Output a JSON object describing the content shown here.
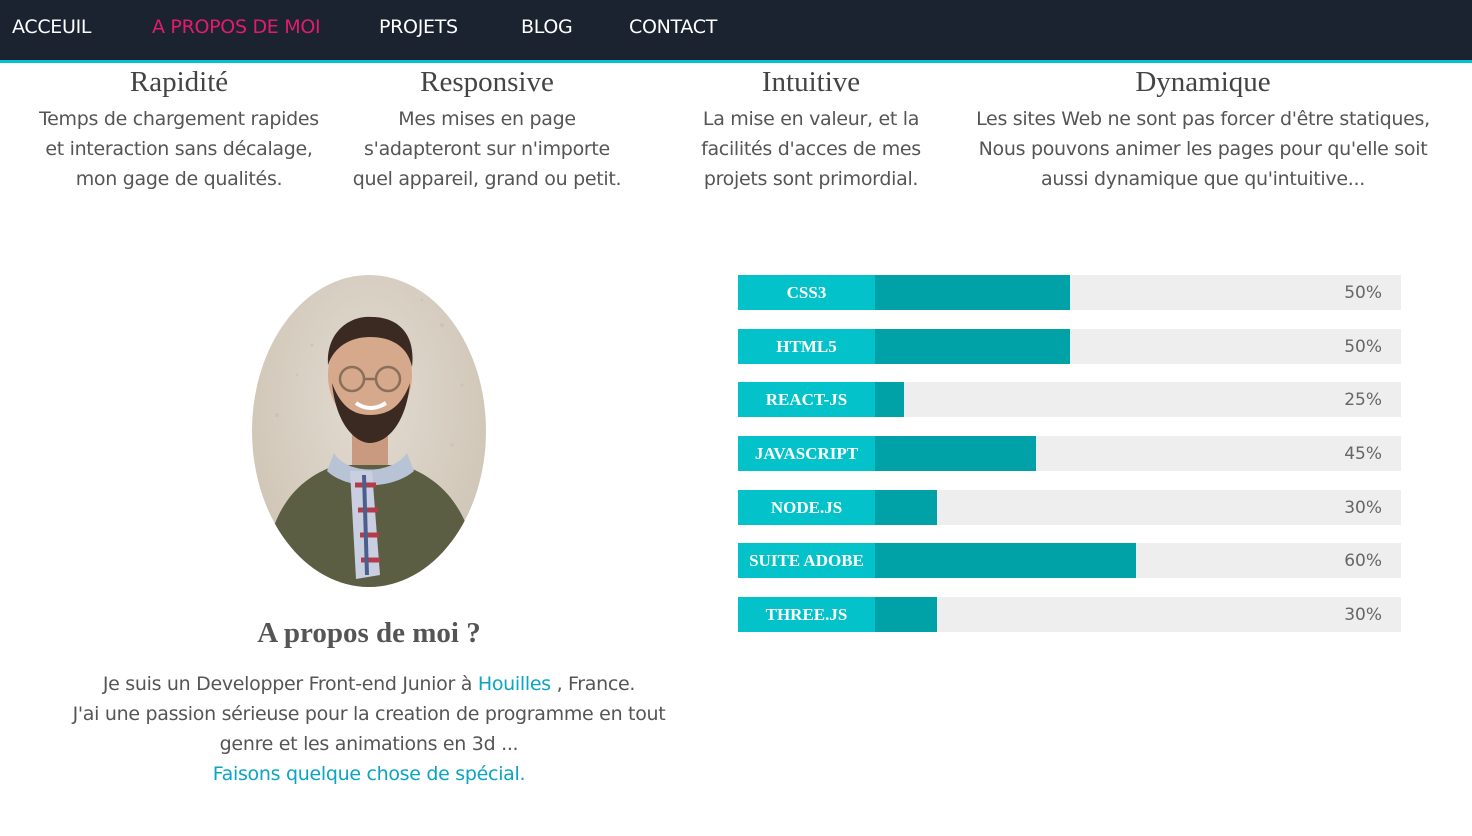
{
  "nav": {
    "items": [
      {
        "label": "ACCEUIL",
        "active": false
      },
      {
        "label": "A PROPOS DE MOI",
        "active": true
      },
      {
        "label": "PROJETS",
        "active": false
      },
      {
        "label": "BLOG",
        "active": false
      },
      {
        "label": "CONTACT",
        "active": false
      }
    ]
  },
  "features": [
    {
      "title": "Rapidité",
      "lines": [
        "Temps de chargement rapides",
        "et interaction sans décalage,",
        "mon gage de qualités."
      ]
    },
    {
      "title": "Responsive",
      "lines": [
        "Mes mises en page",
        "s'adapteront sur n'importe",
        "quel appareil, grand ou petit."
      ]
    },
    {
      "title": "Intuitive",
      "lines": [
        "La mise en valeur, et la",
        "facilités d'acces de mes",
        "projets sont primordial."
      ]
    },
    {
      "title": "Dynamique",
      "lines": [
        "Les sites Web ne sont pas forcer d'être statiques,",
        "Nous pouvons animer les pages pour qu'elle soit",
        "aussi dynamique que qu'intuitive..."
      ]
    }
  ],
  "about": {
    "title": "A propos de moi ?",
    "line1_before": "Je suis un Developper Front-end Junior à",
    "city_link": "Houilles",
    "line1_after": ", France.",
    "line2": "J'ai une passion sérieuse pour la creation de programme en tout",
    "line3": "genre et les animations en 3d ...",
    "cta_link": "Faisons quelque chose de spécial."
  },
  "skills": [
    {
      "name": "CSS3",
      "percent_label": "50%",
      "value": 50
    },
    {
      "name": "HTML5",
      "percent_label": "50%",
      "value": 50
    },
    {
      "name": "REACT-JS",
      "percent_label": "25%",
      "value": 25
    },
    {
      "name": "JAVASCRIPT",
      "percent_label": "45%",
      "value": 45
    },
    {
      "name": "NODE.JS",
      "percent_label": "30%",
      "value": 30
    },
    {
      "name": "SUITE ADOBE",
      "percent_label": "60%",
      "value": 60
    },
    {
      "name": "THREE.JS",
      "percent_label": "30%",
      "value": 30
    }
  ],
  "colors": {
    "nav_bg": "#1b2330",
    "accent_pink": "#e31b6d",
    "accent_teal": "#04c2c9",
    "bar_fill": "#00a1a7",
    "link": "#0aa5c2"
  }
}
